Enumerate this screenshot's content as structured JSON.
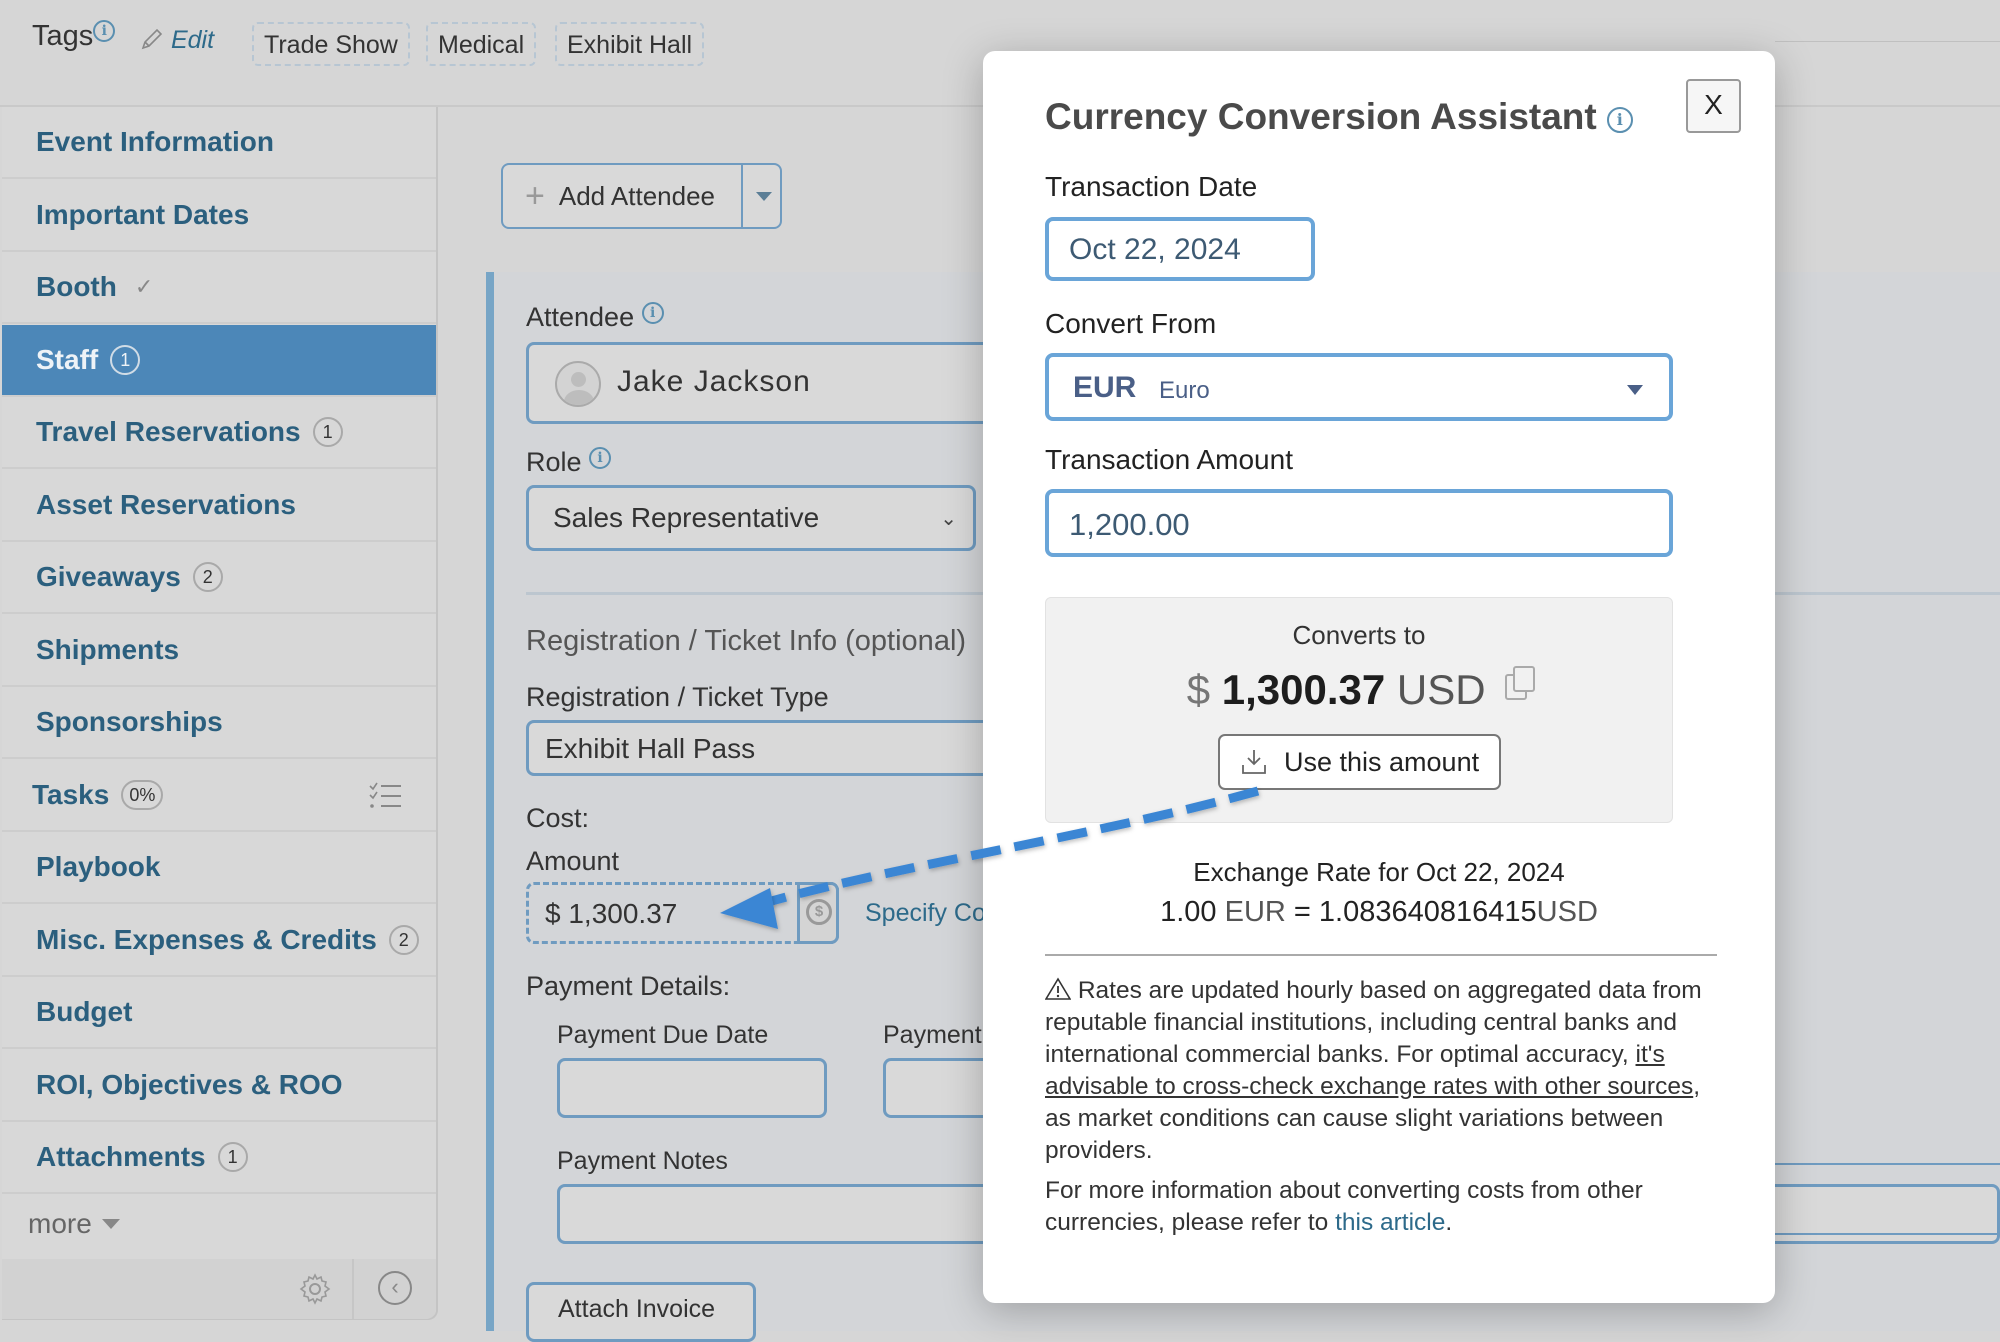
{
  "header": {
    "tags_label": "Tags",
    "edit_label": "Edit",
    "tags": [
      "Trade Show",
      "Medical",
      "Exhibit Hall"
    ]
  },
  "sidebar": {
    "items": [
      {
        "label": "Event Information"
      },
      {
        "label": "Important Dates"
      },
      {
        "label": "Booth",
        "status": "check"
      },
      {
        "label": "Staff",
        "badge": "1",
        "active": true
      },
      {
        "label": "Travel Reservations",
        "badge": "1"
      },
      {
        "label": "Asset Reservations"
      },
      {
        "label": "Giveaways",
        "badge": "2"
      },
      {
        "label": "Shipments"
      },
      {
        "label": "Sponsorships"
      },
      {
        "label": "Tasks",
        "badge": "0%"
      },
      {
        "label": "Playbook"
      },
      {
        "label": "Misc. Expenses & Credits",
        "badge": "2"
      },
      {
        "label": "Budget"
      },
      {
        "label": "ROI, Objectives & ROO"
      },
      {
        "label": "Attachments",
        "badge": "1"
      }
    ],
    "more_label": "more"
  },
  "main": {
    "add_attendee_label": "Add Attendee",
    "attendee_label": "Attendee",
    "attendee_name": "Jake Jackson",
    "role_label": "Role",
    "role_value": "Sales Representative",
    "registration_heading": "Registration / Ticket Info (optional)",
    "ticket_type_label": "Registration / Ticket Type",
    "ticket_type_value": "Exhibit Hall Pass",
    "cost_label": "Cost:",
    "amount_label": "Amount",
    "amount_value": "$ 1,300.37",
    "specify_link": "Specify Co",
    "payment_details_label": "Payment Details:",
    "payment_due_date_label": "Payment Due Date",
    "payment_due_date_value": "",
    "payment_second_label": "Payment",
    "payment_notes_label": "Payment Notes",
    "payment_notes_value": "",
    "attach_invoice_label": "Attach Invoice"
  },
  "modal": {
    "title": "Currency Conversion Assistant",
    "close_label": "X",
    "transaction_date_label": "Transaction Date",
    "transaction_date_value": "Oct 22, 2024",
    "convert_from_label": "Convert From",
    "convert_from_code": "EUR",
    "convert_from_name": "Euro",
    "transaction_amount_label": "Transaction Amount",
    "transaction_amount_value": "1,200.00",
    "converts_to_label": "Converts to",
    "converted_symbol": "$",
    "converted_amount": "1,300.37",
    "converted_code": "USD",
    "use_amount_label": "Use this amount",
    "rate_title": "Exchange Rate for Oct 22, 2024",
    "rate_base_amount": "1.00",
    "rate_base_code": "EUR",
    "rate_equals": "=",
    "rate_quote_amount": "1.083640816415",
    "rate_quote_code": "USD",
    "disclaimer_pre": "Rates are updated hourly based on aggregated data from reputable financial institutions, including central banks and international commercial banks. For optimal accuracy, ",
    "disclaimer_link": "it's advisable to cross-check exchange rates with other sources",
    "disclaimer_post": ", as market conditions can cause slight variations between providers.",
    "more_info_pre": "For more information about converting costs from other currencies, please refer to ",
    "more_info_link": "this article",
    "more_info_post": "."
  },
  "colors": {
    "accent": "#4c87b8",
    "link": "#2d6a8a",
    "annotation_arrow": "#3a86d4"
  }
}
